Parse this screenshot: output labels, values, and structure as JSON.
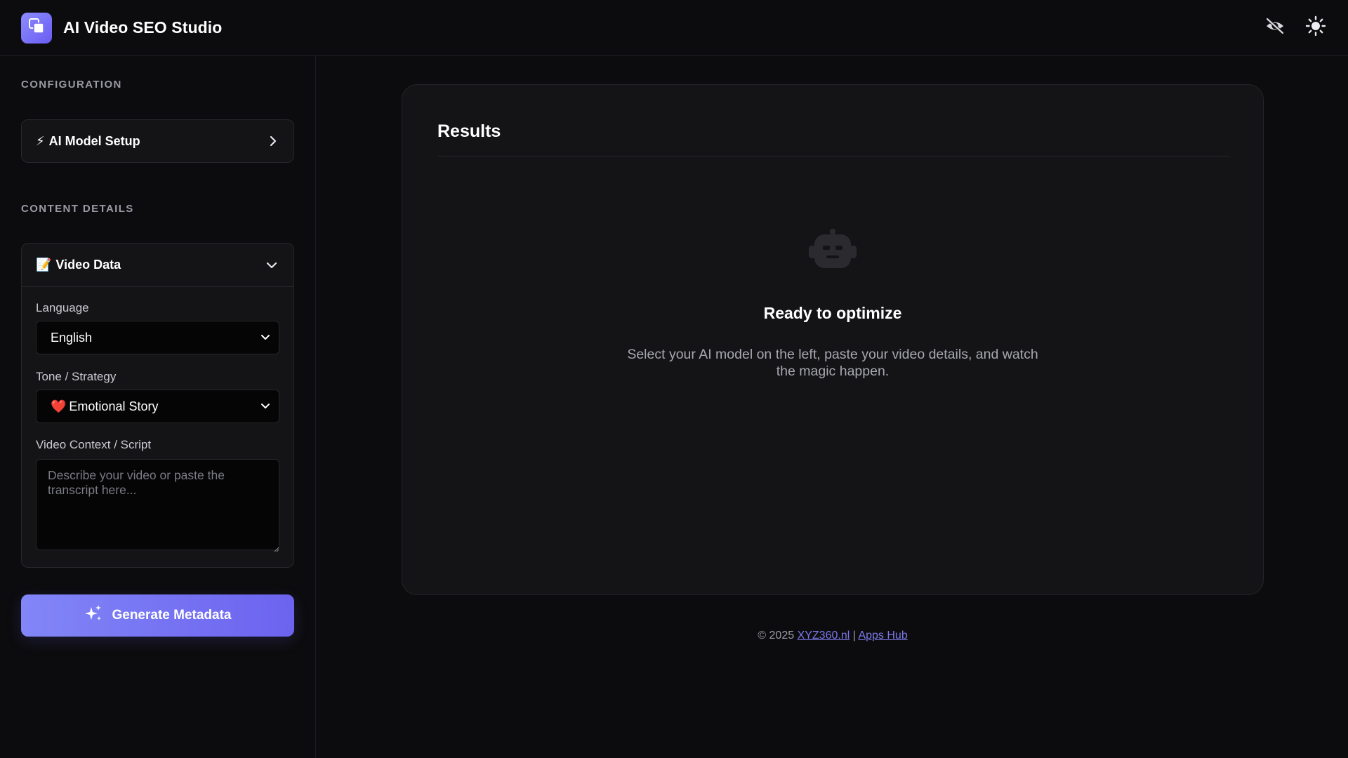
{
  "header": {
    "title": "AI Video SEO Studio",
    "icons": [
      "layers-icon",
      "eye-off-icon",
      "sun-icon"
    ]
  },
  "sidebar": {
    "config_label": "CONFIGURATION",
    "model_setup": {
      "emoji": "⚡",
      "label": "AI Model Setup"
    },
    "content_label": "CONTENT DETAILS",
    "video_data": {
      "emoji": "📝",
      "label": "Video Data",
      "language_label": "Language",
      "language_value": "English",
      "tone_label": "Tone / Strategy",
      "tone_emoji": "❤️",
      "tone_value": "Emotional Story",
      "context_label": "Video Context / Script",
      "context_placeholder": "Describe your video or paste the transcript here..."
    },
    "generate_button": "Generate Metadata"
  },
  "main": {
    "results_title": "Results",
    "empty_title": "Ready to optimize",
    "empty_desc": "Select your AI model on the left, paste your video details, and watch the magic happen."
  },
  "footer": {
    "copyright": "© 2025",
    "link1": "XYZ360.nl",
    "separator": "|",
    "link2": "Apps Hub"
  },
  "colors": {
    "background": "#0c0c0e",
    "panel": "#141417",
    "accent": "#7b78e8",
    "button_gradient_start": "#8286f7",
    "button_gradient_end": "#6c63ef"
  }
}
